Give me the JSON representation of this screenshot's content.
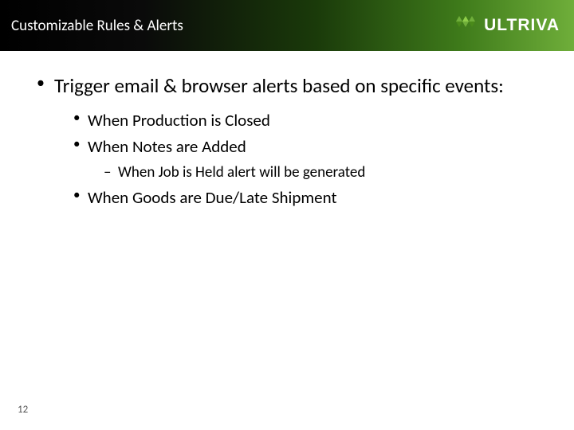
{
  "header": {
    "title": "Customizable Rules & Alerts",
    "brand": "ULTRIVA"
  },
  "bullets": {
    "l1_0": "Trigger email & browser alerts based on specific events:",
    "l2_0": "When Production is Closed",
    "l2_1": "When Notes are Added",
    "l3_0": "When Job is Held alert will be generated",
    "l2_2": "When Goods are Due/Late Shipment"
  },
  "page_number": "12"
}
